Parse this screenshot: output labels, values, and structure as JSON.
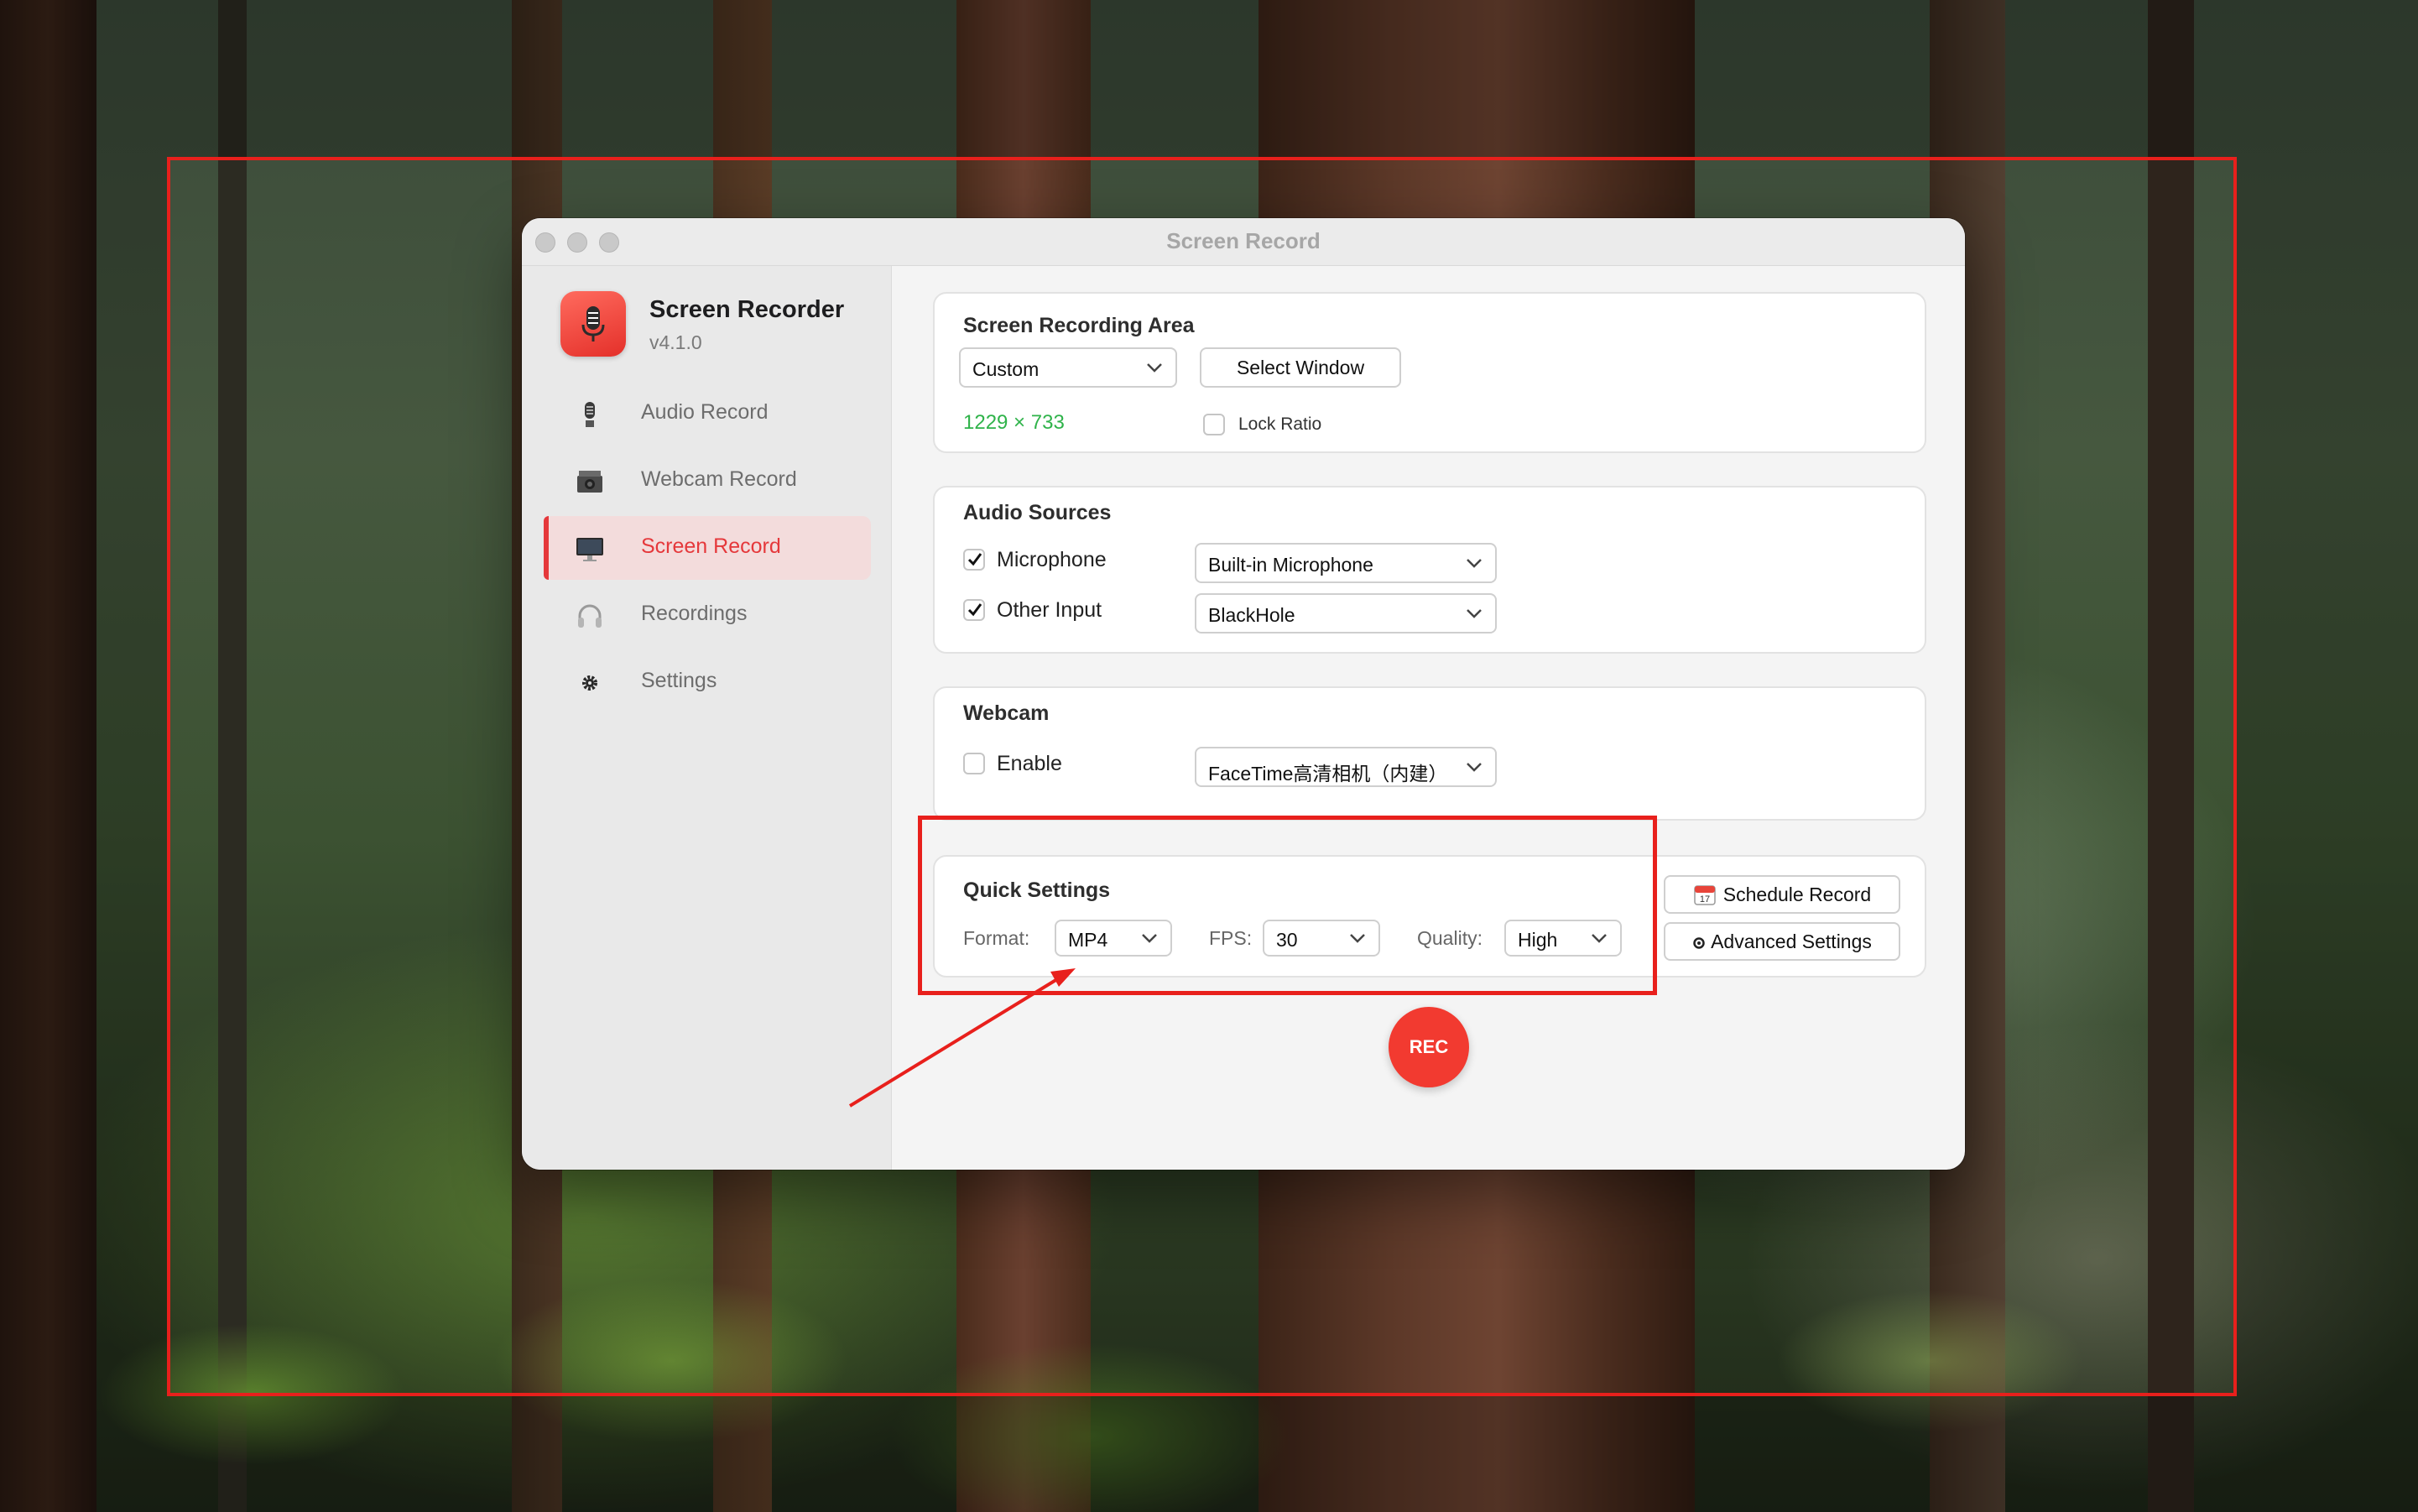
{
  "window": {
    "title": "Screen Record"
  },
  "app": {
    "name": "Screen Recorder",
    "version": "v4.1.0"
  },
  "sidebar": {
    "items": [
      {
        "label": "Audio Record",
        "icon": "microphone-icon"
      },
      {
        "label": "Webcam Record",
        "icon": "camera-icon"
      },
      {
        "label": "Screen Record",
        "icon": "monitor-icon",
        "active": true
      },
      {
        "label": "Recordings",
        "icon": "headphones-icon"
      },
      {
        "label": "Settings",
        "icon": "gear-icon"
      }
    ]
  },
  "recording_area": {
    "title": "Screen Recording Area",
    "mode": "Custom",
    "select_window_label": "Select Window",
    "dimensions": "1229 × 733",
    "lock_ratio_label": "Lock Ratio",
    "lock_ratio_checked": false
  },
  "audio_sources": {
    "title": "Audio Sources",
    "microphone": {
      "label": "Microphone",
      "checked": true,
      "device": "Built-in Microphone"
    },
    "other_input": {
      "label": "Other Input",
      "checked": true,
      "device": "BlackHole"
    }
  },
  "webcam": {
    "title": "Webcam",
    "enable_label": "Enable",
    "enabled": false,
    "device": "FaceTime高清相机（内建）"
  },
  "quick_settings": {
    "title": "Quick Settings",
    "format_label": "Format:",
    "format": "MP4",
    "fps_label": "FPS:",
    "fps": "30",
    "quality_label": "Quality:",
    "quality": "High"
  },
  "actions": {
    "schedule_label": "Schedule Record",
    "advanced_label": "Advanced Settings",
    "schedule_icon": "calendar-icon",
    "advanced_icon": "gear-icon"
  },
  "rec_button": {
    "label": "REC"
  },
  "colors": {
    "accent": "#e5383b",
    "rec": "#f23a30",
    "dimension_text": "#2fb34a",
    "annotation": "#e8201c"
  }
}
